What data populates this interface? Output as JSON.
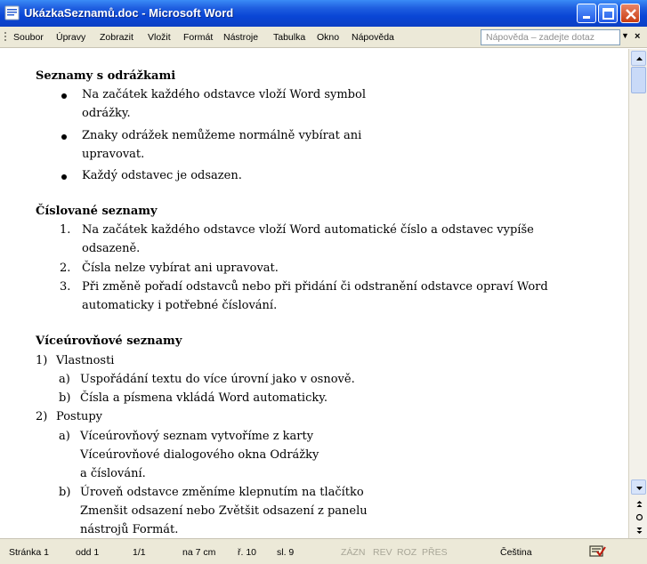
{
  "window": {
    "title": "UkázkaSeznamů.doc - Microsoft Word",
    "icons": [
      "word-app-icon",
      "minimize-icon",
      "maximize-icon",
      "close-icon"
    ]
  },
  "menu": {
    "items": [
      "Soubor",
      "Úpravy",
      "Zobrazit",
      "Vložit",
      "Formát",
      "Nástroje",
      "Tabulka",
      "Okno",
      "Nápověda"
    ],
    "help_placeholder": "Nápověda – zadejte dotaz",
    "dropdown_glyph": "▼",
    "close_glyph": "×"
  },
  "doc": {
    "section1": {
      "heading": "Seznamy s odrážkami",
      "lines": [
        "Na začátek každého odstavce vloží Word symbol",
        "odrážky.",
        "Znaky odrážek nemůžeme normálně vybírat ani",
        "upravovat.",
        "Každý odstavec je odsazen."
      ]
    },
    "section2": {
      "heading": "Číslované seznamy",
      "markers": [
        "1.",
        "2.",
        "3."
      ],
      "lines": [
        "Na začátek každého odstavce vloží Word automatické číslo a odstavec vypíše",
        "odsazeně.",
        "Čísla nelze vybírat ani upravovat.",
        "Při změně pořadí odstavců nebo při přidání či odstranění odstavce opraví Word",
        "automaticky i potřebné číslování."
      ]
    },
    "section3": {
      "heading": "Víceúrovňové seznamy",
      "markers": [
        "1)",
        "a)",
        "b)",
        "2)",
        "a)",
        "b)"
      ],
      "lines": [
        "Vlastnosti",
        "Uspořádání textu do více úrovní jako v osnově.",
        "Čísla a písmena vkládá Word automaticky.",
        "Postupy",
        "Víceúrovňový seznam vytvoříme z karty",
        "Víceúrovňové dialogového okna Odrážky",
        "a číslování.",
        "Úroveň odstavce změníme klepnutím na tlačítko",
        "Zmenšit odsazení nebo Zvětšit odsazení z panelu",
        "nástrojů Formát."
      ]
    }
  },
  "status": {
    "page": "Stránka 1",
    "section": "odd 1",
    "pages": "1/1",
    "at": "na 7 cm",
    "line": "ř. 10",
    "col": "sl. 9",
    "modes": [
      "ZÁZN",
      "REV",
      "ROZ",
      "PŘES"
    ],
    "language": "Čeština"
  },
  "colors": {
    "titlebar": "#0a46d6",
    "chrome": "#ece9d8",
    "dim_text": "#a8a697"
  }
}
